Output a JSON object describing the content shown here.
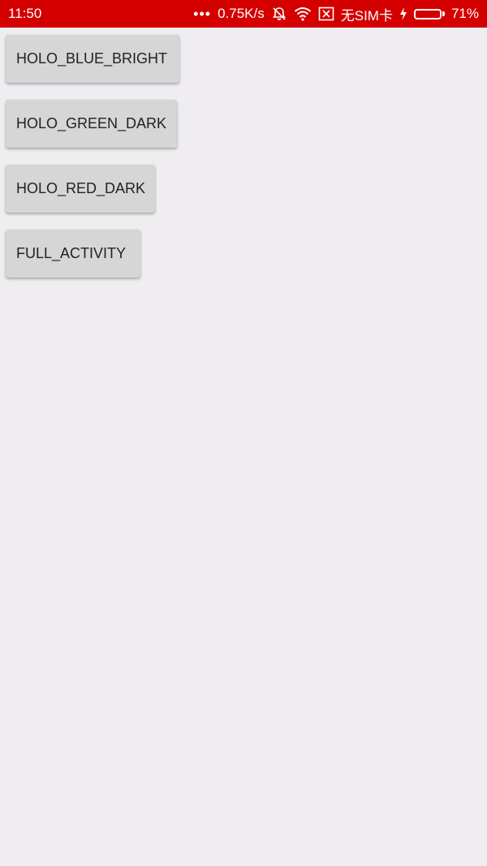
{
  "status_bar": {
    "time": "11:50",
    "dots": "•••",
    "network_speed": "0.75K/s",
    "sim": "无SIM卡",
    "battery_percent": "71%",
    "battery_level": 0.71,
    "background": "#d40000",
    "icons": [
      "more-dots-icon",
      "alarm-off-icon",
      "wifi-icon",
      "no-sim-icon",
      "charging-icon",
      "battery-icon"
    ]
  },
  "buttons": [
    {
      "label": "HOLO_BLUE_BRIGHT"
    },
    {
      "label": "HOLO_GREEN_DARK"
    },
    {
      "label": "HOLO_RED_DARK"
    },
    {
      "label": "FULL_ACTIVITY"
    }
  ]
}
